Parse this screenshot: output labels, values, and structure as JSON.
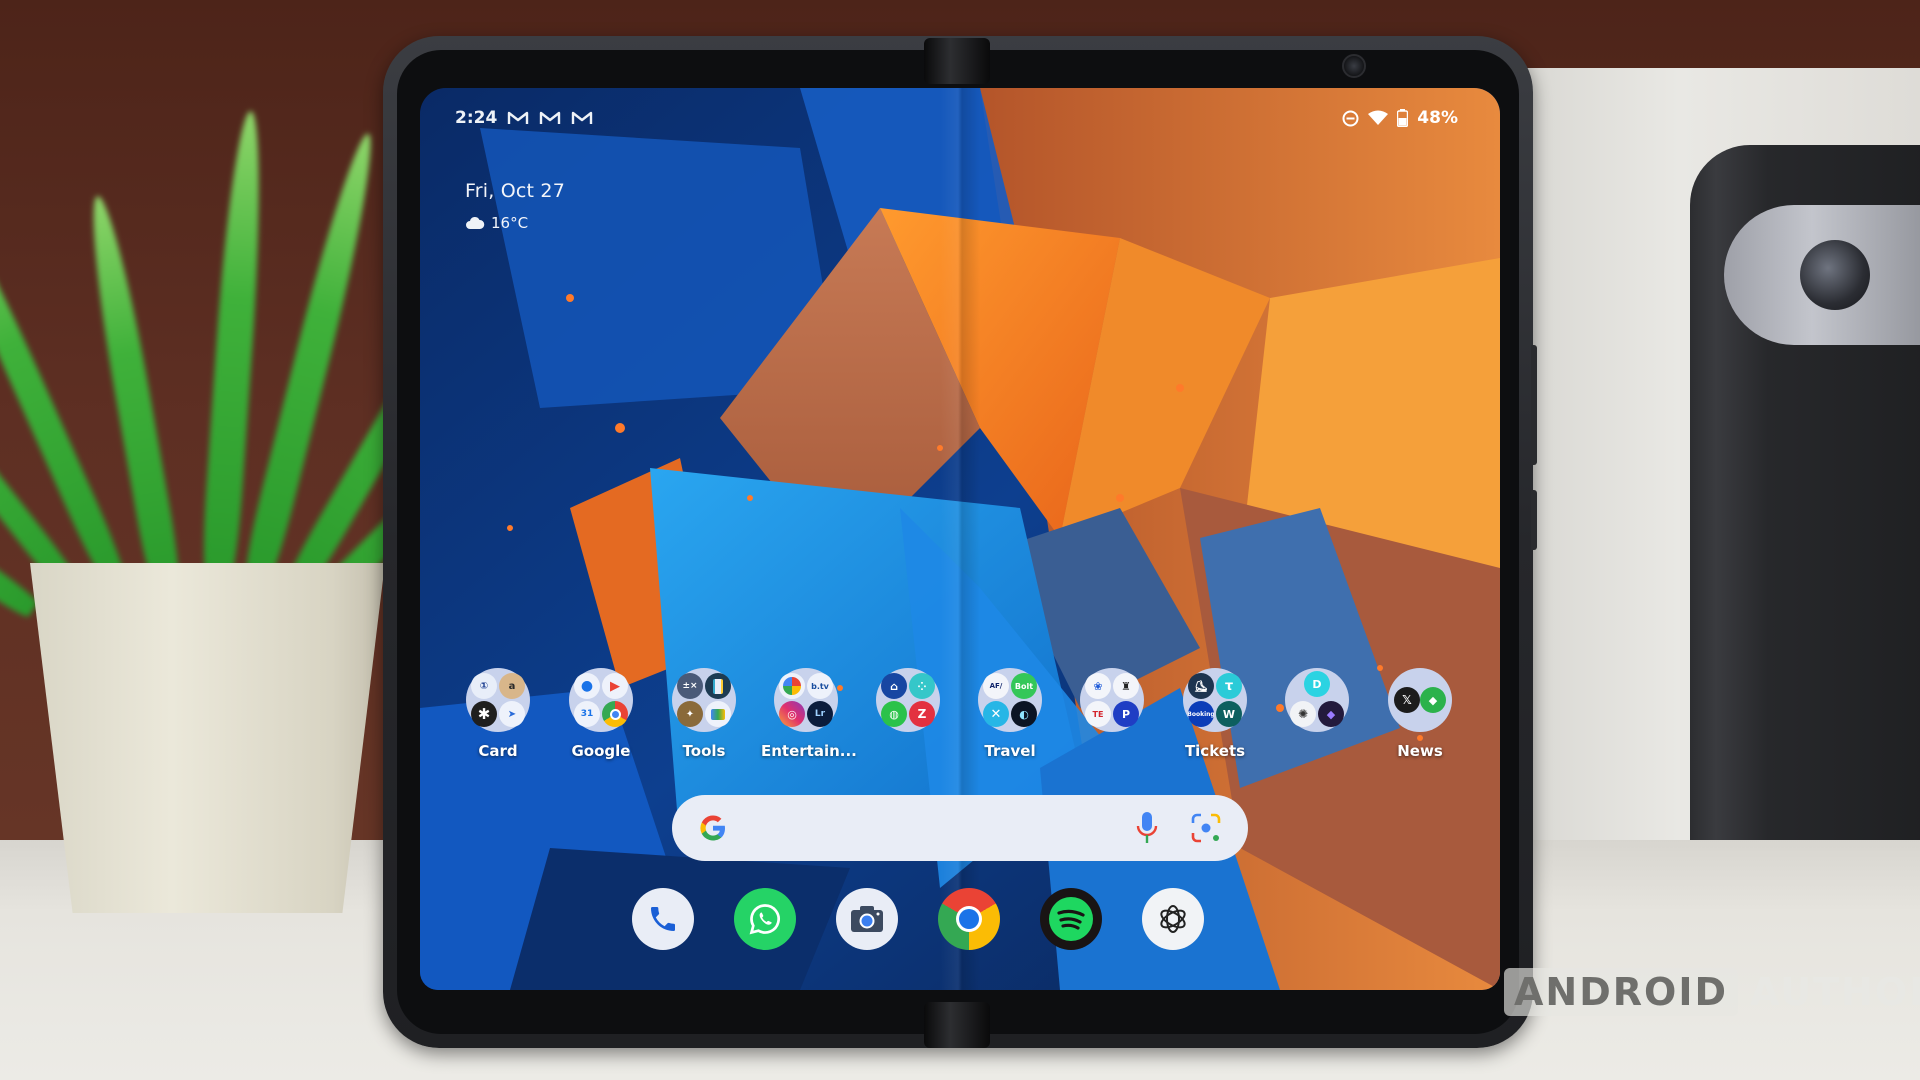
{
  "status_bar": {
    "time": "2:24",
    "notification_icons": [
      "gmail-icon",
      "gmail-icon",
      "gmail-icon"
    ],
    "right_icons": [
      "do-not-disturb-icon",
      "wifi-icon",
      "battery-icon"
    ],
    "battery_percent": "48%"
  },
  "glance": {
    "date": "Fri, Oct 27",
    "weather_icon": "cloudy-icon",
    "temperature": "16°C"
  },
  "folders": [
    {
      "label": "Card",
      "apps": [
        "1password",
        "amazon",
        "perplexity",
        "navigation"
      ]
    },
    {
      "label": "Google",
      "apps": [
        "messages",
        "play-store",
        "calendar",
        "chrome-beta"
      ]
    },
    {
      "label": "Tools",
      "apps": [
        "calculator",
        "phone-tool",
        "galaxy-bud",
        "files"
      ]
    },
    {
      "label": "Entertain...",
      "apps": [
        "google-photos",
        "btv",
        "instagram",
        "lightroom"
      ]
    },
    {
      "label": "",
      "apps": [
        "router",
        "fitbit",
        "wechat",
        "zenly"
      ]
    },
    {
      "label": "Travel",
      "apps": [
        "air-france",
        "bolt",
        "ratp",
        "ouigo"
      ]
    },
    {
      "label": "",
      "apps": [
        "bouygues",
        "dino",
        "totalenergies",
        "paypal"
      ]
    },
    {
      "label": "Tickets",
      "apps": [
        "skate",
        "tiqets",
        "booking",
        "wattpad"
      ]
    },
    {
      "label": "",
      "apps": [
        "dashlane",
        "chatgpt",
        "obsidian"
      ]
    },
    {
      "label": "News",
      "apps": [
        "x",
        "feedly"
      ]
    }
  ],
  "search": {
    "g_logo": "google-g-icon",
    "mic": "microphone-icon",
    "lens": "google-lens-icon"
  },
  "dock": [
    {
      "name": "phone",
      "bg": "#e9edf6"
    },
    {
      "name": "whatsapp",
      "bg": "#25d366"
    },
    {
      "name": "camera",
      "bg": "#e9edf6"
    },
    {
      "name": "chrome",
      "bg": "#ffffff"
    },
    {
      "name": "spotify",
      "bg": "#191414"
    },
    {
      "name": "chatgpt",
      "bg": "#f1f3f6"
    }
  ],
  "watermark": {
    "boxed": "ANDROID",
    "plain": "AUTHORITY"
  },
  "colors": {
    "folder_bg": "#c8d2ec",
    "search_bg": "#e9edf6",
    "wallpaper_blue": "#1565c0",
    "wallpaper_orange": "#f57c1f"
  }
}
